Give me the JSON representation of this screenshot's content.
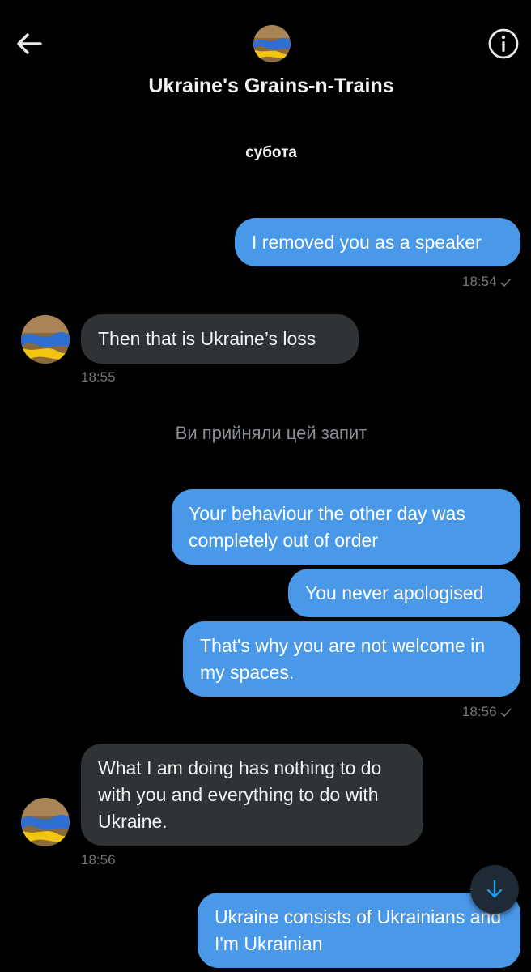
{
  "header": {
    "title": "Ukraine's Grains-n-Trains",
    "back_icon": "arrow-left-icon",
    "info_icon": "info-icon"
  },
  "conversation": {
    "day_label": "субота",
    "system_message": "Ви прийняли цей запит",
    "messages": [
      {
        "from": "me",
        "text": "I removed you as a speaker"
      },
      {
        "from": "me",
        "time": "18:54",
        "read": true
      },
      {
        "from": "them",
        "text": "Then that is Ukraine’s loss",
        "time": "18:55"
      },
      {
        "from": "me",
        "text": "Your behaviour the other day was completely out of order"
      },
      {
        "from": "me",
        "text": "You never apologised"
      },
      {
        "from": "me",
        "text": "That's why you are not welcome in my spaces.",
        "time": "18:56",
        "read": true
      },
      {
        "from": "them",
        "text": "What I am doing has nothing to do with you and everything to do with Ukraine.",
        "time": "18:56"
      },
      {
        "from": "me",
        "text": "Ukraine consists of Ukrainians and I'm Ukrainian"
      }
    ]
  },
  "colors": {
    "background": "#000000",
    "sent_bubble": "#4a99e9",
    "received_bubble": "#2f3336",
    "timestamp": "#71767b",
    "accent": "#1d9bf0"
  },
  "scroll_button_icon": "arrow-down-icon"
}
